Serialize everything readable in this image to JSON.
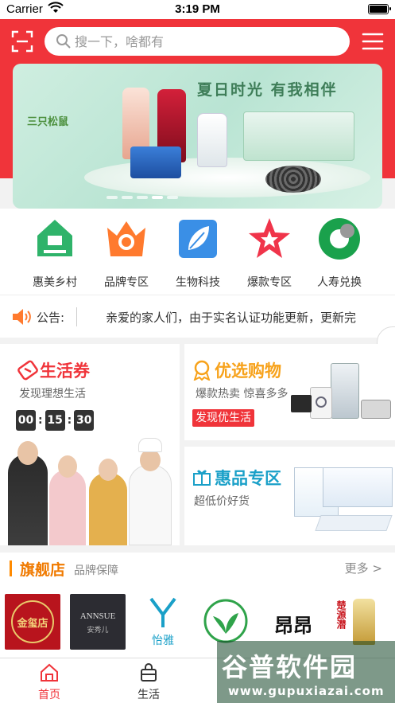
{
  "status_bar": {
    "carrier": "Carrier",
    "time": "3:19 PM"
  },
  "search": {
    "placeholder": "搜一下，啥都有"
  },
  "banner": {
    "slogan": "夏日时光 有我相伴",
    "brand": "三只松鼠",
    "active_slide": 4,
    "slide_count": 5
  },
  "categories": [
    {
      "label": "惠美乡村",
      "icon": "house-icon",
      "color": "#2fb36a"
    },
    {
      "label": "品牌专区",
      "icon": "crown-icon",
      "color": "#ff7a2e"
    },
    {
      "label": "生物科技",
      "icon": "leaf-book-icon",
      "color": "#3a8fe6"
    },
    {
      "label": "爆款专区",
      "icon": "star-icon",
      "color": "#f0344a"
    },
    {
      "label": "人寿兑换",
      "icon": "swirl-icon",
      "color": "#1aa14c"
    }
  ],
  "notice": {
    "label": "公告:",
    "text": "亲爱的家人们，由于实名认证功能更新，更新完"
  },
  "life_coupon": {
    "title": "生活券",
    "subtitle": "发现理想生活",
    "timer": [
      "00",
      "15",
      "30"
    ]
  },
  "selected_shopping": {
    "title": "优选购物",
    "subtitle": "爆款热卖 惊喜多多",
    "button": "发现优生活"
  },
  "benefit_zone": {
    "title": "惠品专区",
    "subtitle": "超低价好货"
  },
  "flagship": {
    "title": "旗舰店",
    "subtitle": "品牌保障",
    "more": "更多 >"
  },
  "brands": [
    {
      "name": "金玺店"
    },
    {
      "name": "ANNSUE",
      "cn": "安秀儿"
    },
    {
      "name": "怡雅"
    },
    {
      "name": "green-leaf-logo"
    },
    {
      "name": "昂昂"
    },
    {
      "name": "楚源潜"
    }
  ],
  "tabs": [
    {
      "label": "首页",
      "active": true
    },
    {
      "label": "生活",
      "active": false
    }
  ],
  "watermark": {
    "title": "谷普软件园",
    "url": "www.gupuxiazai.com"
  },
  "colors": {
    "primary": "#f0343a",
    "orange": "#f07a00",
    "teal": "#1aa0c8"
  }
}
